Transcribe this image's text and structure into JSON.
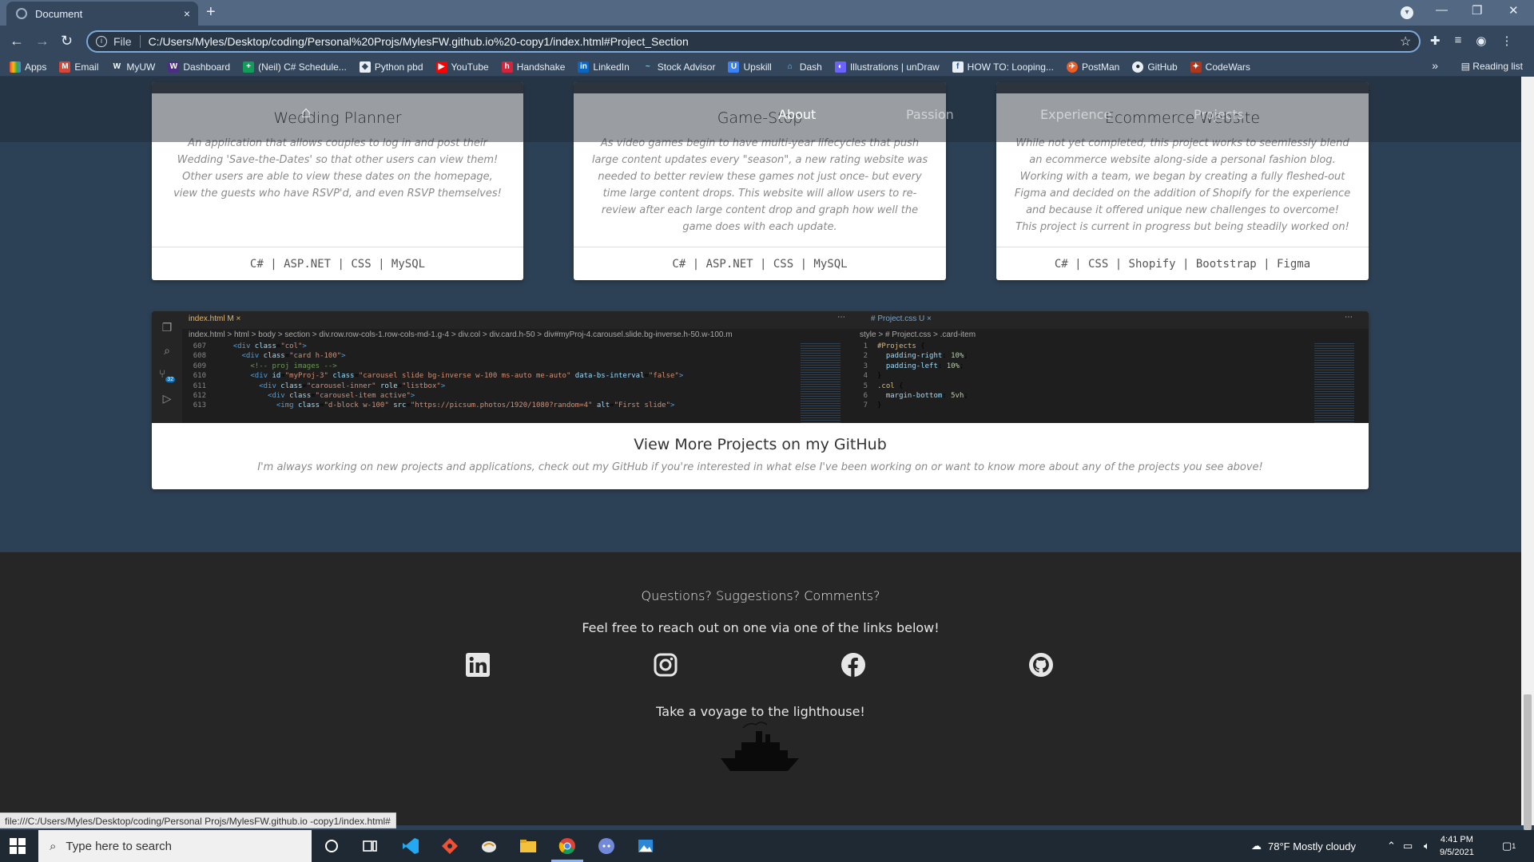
{
  "browser": {
    "tab_title": "Document",
    "tab_close": "×",
    "new_tab": "+",
    "url_prefix": "File",
    "url": "C:/Users/Myles/Desktop/coding/Personal%20Projs/MylesFW.github.io%20-copy1/index.html#Project_Section",
    "bookmarks": [
      "Apps",
      "Email",
      "MyUW",
      "Dashboard",
      "(Neil) C# Schedule...",
      "Python pbd",
      "YouTube",
      "Handshake",
      "LinkedIn",
      "Stock Advisor",
      "Upskill",
      "Dash",
      "Illustrations | unDraw",
      "HOW TO: Looping...",
      "PostMan",
      "GitHub",
      "CodeWars"
    ],
    "more_bookmarks": "»",
    "reading_list": "Reading list",
    "status_url": "file:///C:/Users/Myles/Desktop/coding/Personal Projs/MylesFW.github.io -copy1/index.html#"
  },
  "nav": {
    "about": "About",
    "passion": "Passion",
    "experience": "Experience",
    "projects": "Projects"
  },
  "projects": [
    {
      "title": "Wedding Planner",
      "description": "An application that allows couples to log in and post their Wedding 'Save-the-Dates' so that other users can view them! Other users are able to view these dates on the homepage, view the guests who have RSVP'd, and even RSVP themselves!",
      "tech": "C#  |  ASP.NET  |  CSS  |  MySQL"
    },
    {
      "title": "Game-Stop",
      "description": "As video games begin to have multi-year lifecycles that push large content updates every \"season\", a new rating website was needed to better review these games not just once- but every time large content drops. This website will allow users to re-review after each large content drop and graph how well the game does with each update.",
      "tech": "C#  |  ASP.NET  |  CSS  |  MySQL"
    },
    {
      "title": "Ecommerce Website",
      "description": "While not yet completed, this project works to seemlessly blend an ecommerce website along-side a personal fashion blog. Working with a team, we began by creating a fully fleshed-out Figma and decided on the addition of Shopify for the experience and because it offered unique new challenges to overcome! This project is current in progress but being steadily worked on!",
      "tech": "C#  |  CSS  |  Shopify  |  Bootstrap  |  Figma"
    }
  ],
  "vscode": {
    "tab1": "index.html M ×",
    "tab2": "# Project.css U ×",
    "crumbs_left": "index.html > html > body > section > div.row.row-cols-1.row-cols-md-1.g-4 > div.col > div.card.h-50 > div#myProj-4.carousel.slide.bg-inverse.h-50.w-100.m",
    "crumbs_right": "style > # Project.css > .card-item",
    "badge": "32"
  },
  "github_card": {
    "title": "View More Projects on my GitHub",
    "text": "I'm always working on new projects and applications, check out my GitHub if you're interested in what else I've been working on or want to know more about any of the projects you see above!"
  },
  "footer": {
    "question": "Questions? Suggestions? Comments?",
    "reach_out": "Feel free to reach out on one via one of the links below!",
    "voyage": "Take a voyage to the lighthouse!"
  },
  "taskbar": {
    "search_placeholder": "Type here to search",
    "weather": "78°F  Mostly cloudy",
    "time": "4:41 PM",
    "date": "9/5/2021",
    "notifications": "1"
  },
  "colors": {
    "page_bg": "#2d4156",
    "footer_bg": "#262626",
    "chrome_bg": "#35475d"
  }
}
